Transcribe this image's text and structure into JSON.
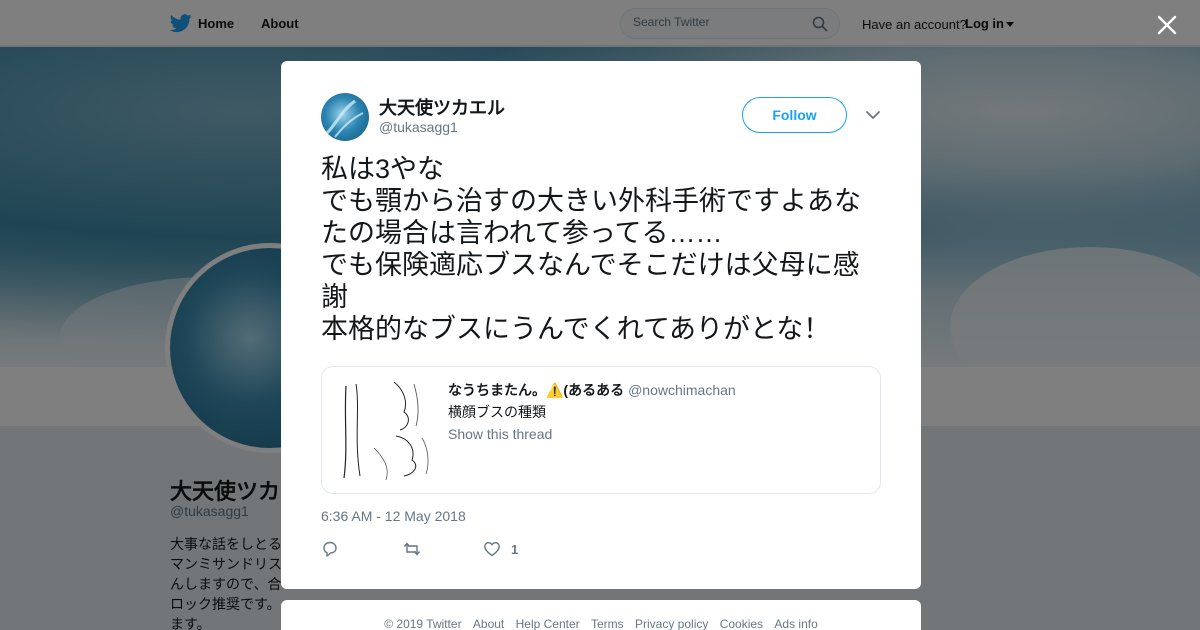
{
  "topbar": {
    "home_label": "Home",
    "about_label": "About",
    "search_placeholder": "Search Twitter",
    "have_account": "Have an account?",
    "login_label": "Log in"
  },
  "profile": {
    "name": "大天使ツカエル",
    "handle": "@tukasagg1",
    "bio_lines": [
      "大事な話をしとる",
      "マンミサンドリス",
      "んしますので、合",
      "ロック推奨です。",
      "ます。"
    ]
  },
  "tweet": {
    "name": "大天使ツカエル",
    "handle": "@tukasagg1",
    "follow_label": "Follow",
    "text_lines": [
      "私は3やな",
      "でも顎から治すの大きい外科手術ですよあな",
      "たの場合は言われて参ってる……",
      "でも保険適応ブスなんでそこだけは父母に感",
      "謝",
      "本格的なブスにうんでくれてありがとな！"
    ],
    "quote": {
      "name": "なうちまたん。⚠️(あるある",
      "handle": "@nowchimachan",
      "text": "横顔ブスの種類",
      "thread_label": "Show this thread"
    },
    "timestamp": "6:36 AM - 12 May 2018",
    "like_count": "1"
  },
  "footer": {
    "links": [
      "© 2019 Twitter",
      "About",
      "Help Center",
      "Terms",
      "Privacy policy",
      "Cookies",
      "Ads info"
    ]
  },
  "colors": {
    "accent": "#1da1f2",
    "text_primary": "#14171a",
    "text_secondary": "#657786",
    "border": "#e1e8ed"
  },
  "icons": {
    "logo": "twitter-bird-icon",
    "search": "search-icon",
    "close": "close-icon",
    "menu": "chevron-down-icon",
    "reply": "reply-icon",
    "retweet": "retweet-icon",
    "like": "heart-icon"
  }
}
